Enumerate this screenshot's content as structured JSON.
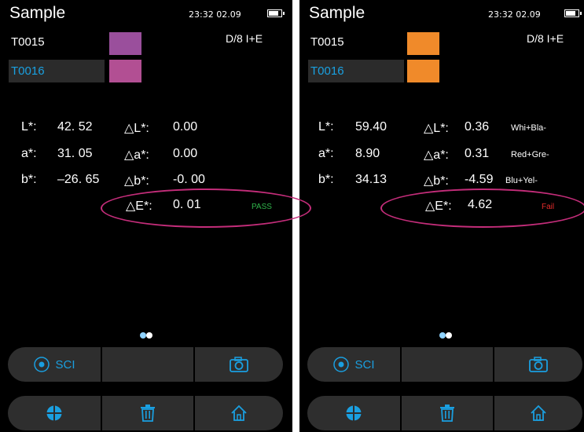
{
  "screens": [
    {
      "title": "Sample",
      "time": "23:32 02.09",
      "mode": "D/8  I+E",
      "samples": [
        {
          "name": "T0015",
          "color": "#9a4f9c"
        },
        {
          "name": "T0016",
          "color": "#b24f93"
        }
      ],
      "measurements": [
        {
          "label": "L*:",
          "value": "42. 52"
        },
        {
          "label": "a*:",
          "value": "31. 05"
        },
        {
          "label": "b*:",
          "value": "–26. 65"
        }
      ],
      "deltas": [
        {
          "label": "△L*:",
          "value": "0.00",
          "hint": ""
        },
        {
          "label": "△a*:",
          "value": "0.00",
          "hint": ""
        },
        {
          "label": "△b*:",
          "value": "-0. 00",
          "hint": ""
        }
      ],
      "delta_e": {
        "label": "△E*:",
        "value": "0. 01",
        "verdict": "PASS"
      },
      "buttons": {
        "sci": "SCI"
      }
    },
    {
      "title": "Sample",
      "time": "23:32 02.09",
      "mode": "D/8  I+E",
      "samples": [
        {
          "name": "T0015",
          "color": "#f08a2a"
        },
        {
          "name": "T0016",
          "color": "#f08a2a"
        }
      ],
      "measurements": [
        {
          "label": "L*:",
          "value": "59.40"
        },
        {
          "label": "a*:",
          "value": "8.90"
        },
        {
          "label": "b*:",
          "value": "34.13"
        }
      ],
      "deltas": [
        {
          "label": "△L*:",
          "value": "0.36",
          "hint": "Whi+Bla-"
        },
        {
          "label": "△a*:",
          "value": "0.31",
          "hint": "Red+Gre-"
        },
        {
          "label": "△b*:",
          "value": "-4.59",
          "hint": "Blu+Yel-"
        }
      ],
      "delta_e": {
        "label": "△E*:",
        "value": "4.62",
        "verdict": "Fail"
      },
      "buttons": {
        "sci": "SCI"
      }
    }
  ],
  "colors": {
    "accent": "#1a9fe0",
    "pass": "#2fb34a",
    "fail": "#e52b2b",
    "highlight": "#c42d7a"
  }
}
